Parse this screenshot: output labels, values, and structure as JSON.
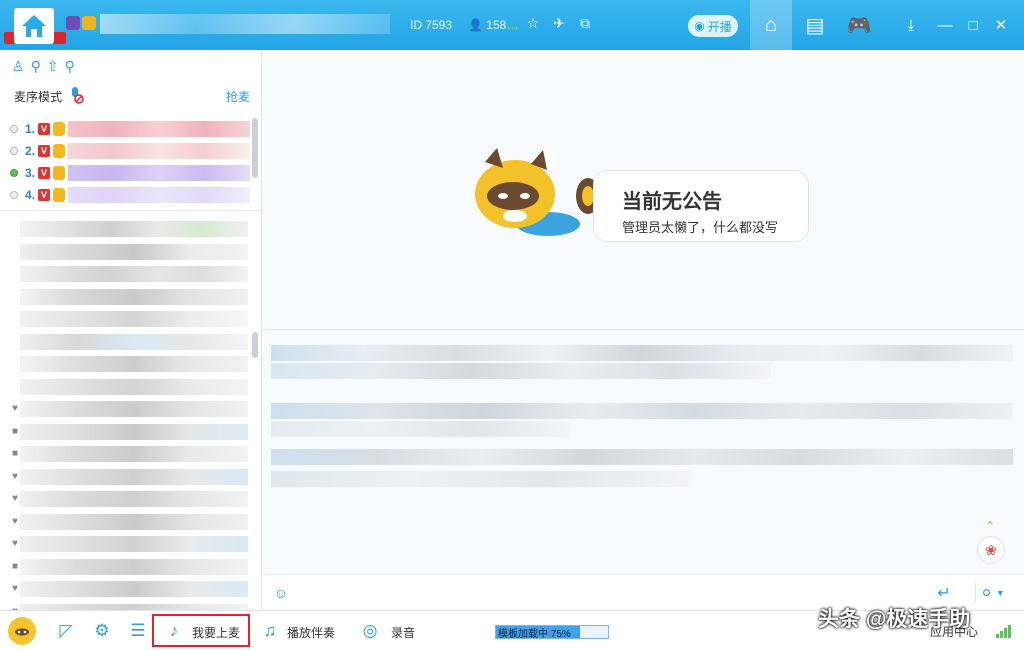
{
  "header": {
    "room_id": "ID 7593",
    "online_count": "158…",
    "live_button": "开播"
  },
  "left_panel": {
    "mode_label": "麦序模式",
    "grab_mic": "抢麦",
    "queue": [
      {
        "num": "1.",
        "v": "V",
        "active": false
      },
      {
        "num": "2.",
        "v": "V",
        "active": false
      },
      {
        "num": "3.",
        "v": "V",
        "active": true
      },
      {
        "num": "4.",
        "v": "V",
        "active": false
      }
    ]
  },
  "announcement": {
    "title": "当前无公告",
    "subtitle": "管理员太懒了，什么都没写"
  },
  "bottom_bar": {
    "request_mic": "我要上麦",
    "play_music": "播放伴奏",
    "record": "录音",
    "loading_text": "模板加载中 75%",
    "loading_progress": 0.75,
    "app_center": "应用中心"
  },
  "watermark": "头条 @极速手助",
  "colors": {
    "accent": "#2f9ce0",
    "topbar": "#2aa9e8",
    "highlight": "#e0242b"
  }
}
